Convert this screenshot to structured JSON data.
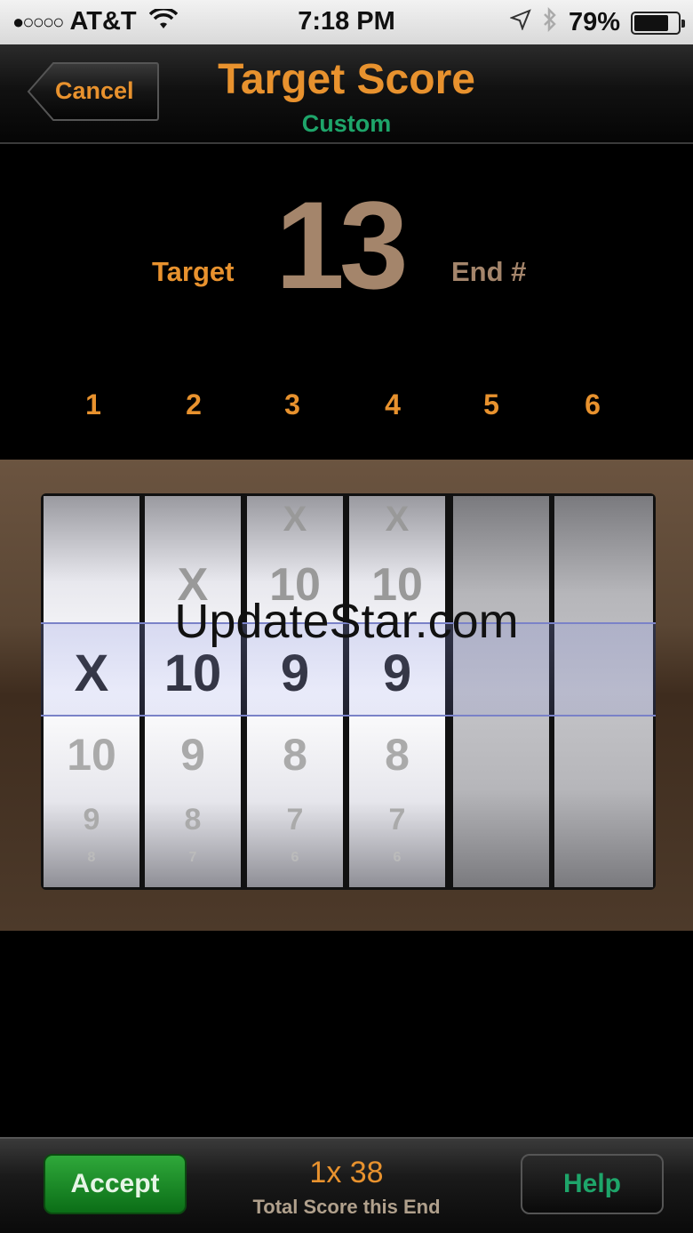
{
  "status_bar": {
    "signal": "●○○○○",
    "carrier": "AT&T",
    "time": "7:18 PM",
    "battery": "79%",
    "battery_level": 0.79
  },
  "nav": {
    "cancel_label": "Cancel",
    "title": "Target Score",
    "subtitle": "Custom"
  },
  "target": {
    "label": "Target",
    "value": "13",
    "end_label": "End #"
  },
  "columns": [
    "1",
    "2",
    "3",
    "4",
    "5",
    "6"
  ],
  "wheels": [
    {
      "above2": "",
      "above1": "",
      "selected": "X",
      "below1": "10",
      "below2": "9",
      "below3": "8"
    },
    {
      "above2": "",
      "above1": "X",
      "selected": "10",
      "below1": "9",
      "below2": "8",
      "below3": "7"
    },
    {
      "above2": "X",
      "above1": "10",
      "selected": "9",
      "below1": "8",
      "below2": "7",
      "below3": "6"
    },
    {
      "above2": "X",
      "above1": "10",
      "selected": "9",
      "below1": "8",
      "below2": "7",
      "below3": "6"
    },
    {
      "above2": "",
      "above1": "",
      "selected": "",
      "below1": "",
      "below2": "",
      "below3": ""
    },
    {
      "above2": "",
      "above1": "",
      "selected": "",
      "below1": "",
      "below2": "",
      "below3": ""
    }
  ],
  "watermark": "UpdateStar.com",
  "bottom": {
    "accept_label": "Accept",
    "help_label": "Help",
    "total_value": "1x 38",
    "total_caption": "Total Score this End"
  },
  "colors": {
    "accent_orange": "#e8922e",
    "accent_green": "#1ea56a",
    "target_brown": "#a4856b"
  }
}
